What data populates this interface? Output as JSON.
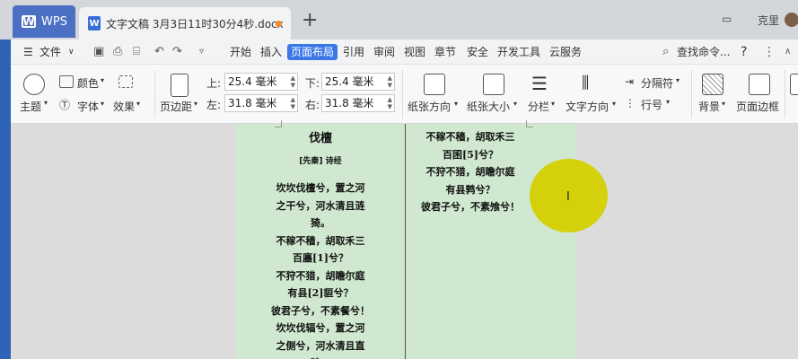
{
  "titlebar": {
    "app_tab": "WPS",
    "doc_tab": "文字文稿 3月3日11时30分4秒.docx",
    "new_tab": "+",
    "user_name": "克里"
  },
  "menubar": {
    "file": "文件",
    "items": [
      "开始",
      "插入",
      "页面布局",
      "引用",
      "审阅",
      "视图",
      "章节",
      "安全",
      "开发工具",
      "云服务"
    ],
    "active": "页面布局",
    "search": "查找命令...",
    "help": "?"
  },
  "ribbon": {
    "theme": "主题",
    "colors": "颜色",
    "fonts": "字体",
    "effects": "效果",
    "margins": "页边距",
    "top_label": "上:",
    "top_value": "25.4 毫米",
    "bottom_label": "下:",
    "bottom_value": "25.4 毫米",
    "left_label": "左:",
    "left_value": "31.8 毫米",
    "right_label": "右:",
    "right_value": "31.8 毫米",
    "orientation": "纸张方向",
    "size": "纸张大小",
    "columns": "分栏",
    "text_direction": "文字方向",
    "breaks": "分隔符",
    "line_numbers": "行号",
    "background": "背景",
    "page_border": "页面边框"
  },
  "document": {
    "title": "伐檀",
    "author": "[先秦] 诗经",
    "left_column": [
      "坎坎伐檀兮，置之河",
      "之干兮，河水清且涟",
      "猗。",
      "不稼不穑，胡取禾三",
      "百廛[1]兮？",
      "不狩不猎，胡瞻尔庭",
      "有县[2]貆兮？",
      "彼君子兮，不素餐兮！",
      "坎坎伐辐兮，置之河",
      "之侧兮，河水清且直",
      "猗。"
    ],
    "right_column": [
      "不稼不穑，胡取禾三",
      "百囷[5]兮？",
      "不狩不猎，胡瞻尔庭",
      "有县鹑兮？",
      "彼君子兮，不素飧兮！"
    ]
  }
}
